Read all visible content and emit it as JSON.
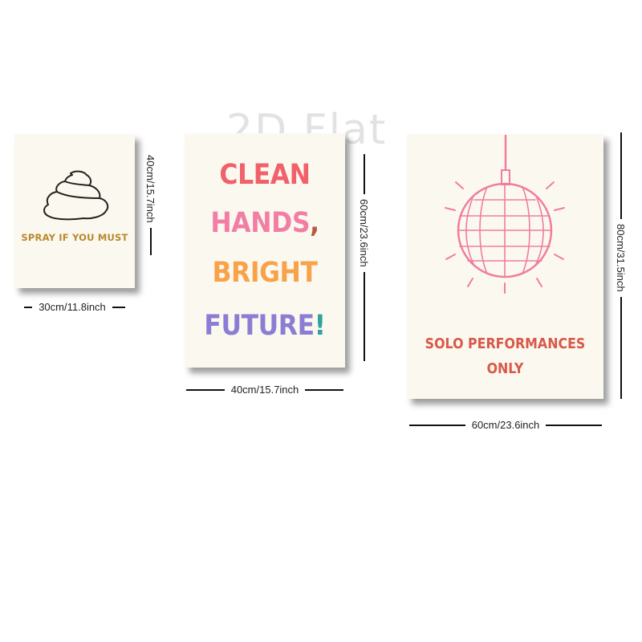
{
  "watermark": "2D Flat",
  "posters": {
    "small": {
      "caption": "SPRAY IF YOU MUST",
      "width_label": "30cm/11.8inch",
      "height_label": "40cm/15.7inch",
      "text_color": "#b7892e",
      "icon": "poop-outline-icon"
    },
    "mid": {
      "lines": [
        "CLEAN",
        "HANDS",
        "BRIGHT",
        "FUTURE"
      ],
      "punct_comma": ",",
      "punct_excl": "!",
      "line_colors": [
        "#f0616b",
        "#f27ea6",
        "#f8a24a",
        "#8c7dd4"
      ],
      "comma_color": "#b45b3c",
      "excl_color": "#2ea39a",
      "width_label": "40cm/15.7inch",
      "height_label": "60cm/23.6inch"
    },
    "large": {
      "caption_line1": "SOLO PERFORMANCES",
      "caption_line2": "ONLY",
      "text_color": "#d9584a",
      "icon": "disco-ball-icon",
      "icon_color": "#f07ca0",
      "width_label": "60cm/23.6inch",
      "height_label": "80cm/31.5inch"
    }
  }
}
